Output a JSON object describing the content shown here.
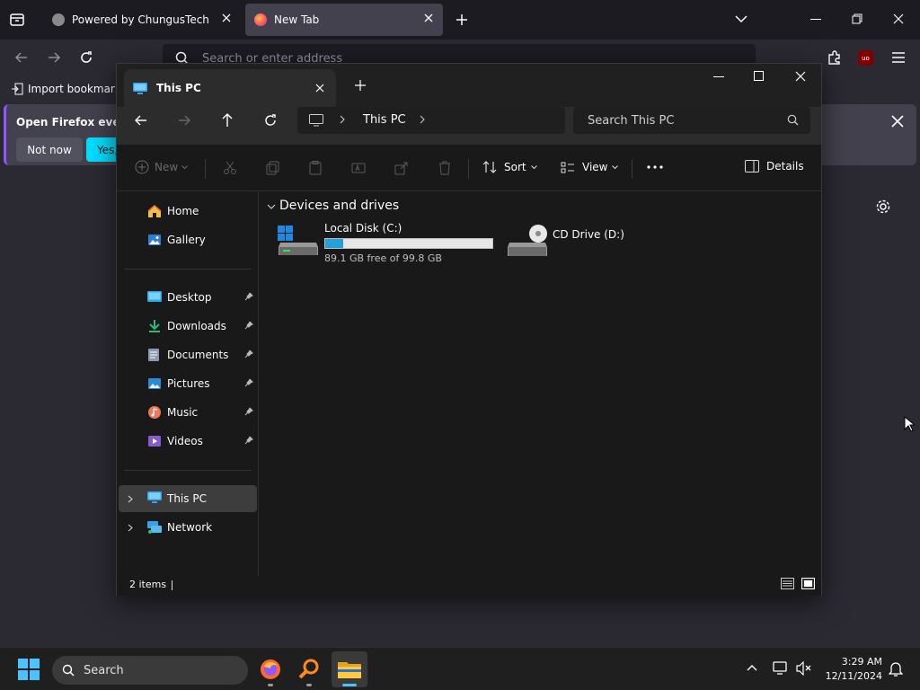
{
  "firefox": {
    "tabs": [
      {
        "label": "Powered by ChungusTech",
        "active": false
      },
      {
        "label": "New Tab",
        "active": true
      }
    ],
    "url_placeholder": "Search or enter address",
    "bookmarks": {
      "import_label": "Import bookmarks"
    },
    "notification": {
      "text": "Open Firefox every",
      "not_now_label": "Not now",
      "yes_label": "Yes,"
    },
    "addon_badge": "uo"
  },
  "explorer": {
    "tab_title": "This PC",
    "breadcrumb": {
      "location": "This PC"
    },
    "search_placeholder": "Search This PC",
    "commands": {
      "new_label": "New",
      "sort_label": "Sort",
      "view_label": "View",
      "details_label": "Details"
    },
    "nav": {
      "top": [
        {
          "label": "Home",
          "icon": "home-icon"
        },
        {
          "label": "Gallery",
          "icon": "gallery-icon"
        }
      ],
      "quick_access": [
        {
          "label": "Desktop",
          "icon": "desktop-folder-icon",
          "pinned": true
        },
        {
          "label": "Downloads",
          "icon": "downloads-icon",
          "pinned": true
        },
        {
          "label": "Documents",
          "icon": "documents-icon",
          "pinned": true
        },
        {
          "label": "Pictures",
          "icon": "pictures-icon",
          "pinned": true
        },
        {
          "label": "Music",
          "icon": "music-icon",
          "pinned": true
        },
        {
          "label": "Videos",
          "icon": "videos-icon",
          "pinned": true
        }
      ],
      "bottom": [
        {
          "label": "This PC",
          "icon": "this-pc-icon",
          "selected": true
        },
        {
          "label": "Network",
          "icon": "network-icon",
          "selected": false
        }
      ]
    },
    "section_title": "Devices and drives",
    "drives": [
      {
        "label": "Local Disk (C:)",
        "free_text": "89.1 GB free of 99.8 GB",
        "used_fraction": 0.107,
        "icon": "local-disk-icon"
      },
      {
        "label": "CD Drive (D:)",
        "icon": "cd-drive-icon"
      }
    ],
    "status": {
      "items": "2 items"
    }
  },
  "taskbar": {
    "search_label": "Search",
    "time": "3:29 AM",
    "date": "12/11/2024"
  },
  "colors": {
    "firefox_accent": "#00ddff",
    "firefox_dark": "#1c1b22",
    "explorer_bg": "#191919",
    "drive_bar_fill": "#26a0da",
    "selection": "#3d3d3d"
  }
}
